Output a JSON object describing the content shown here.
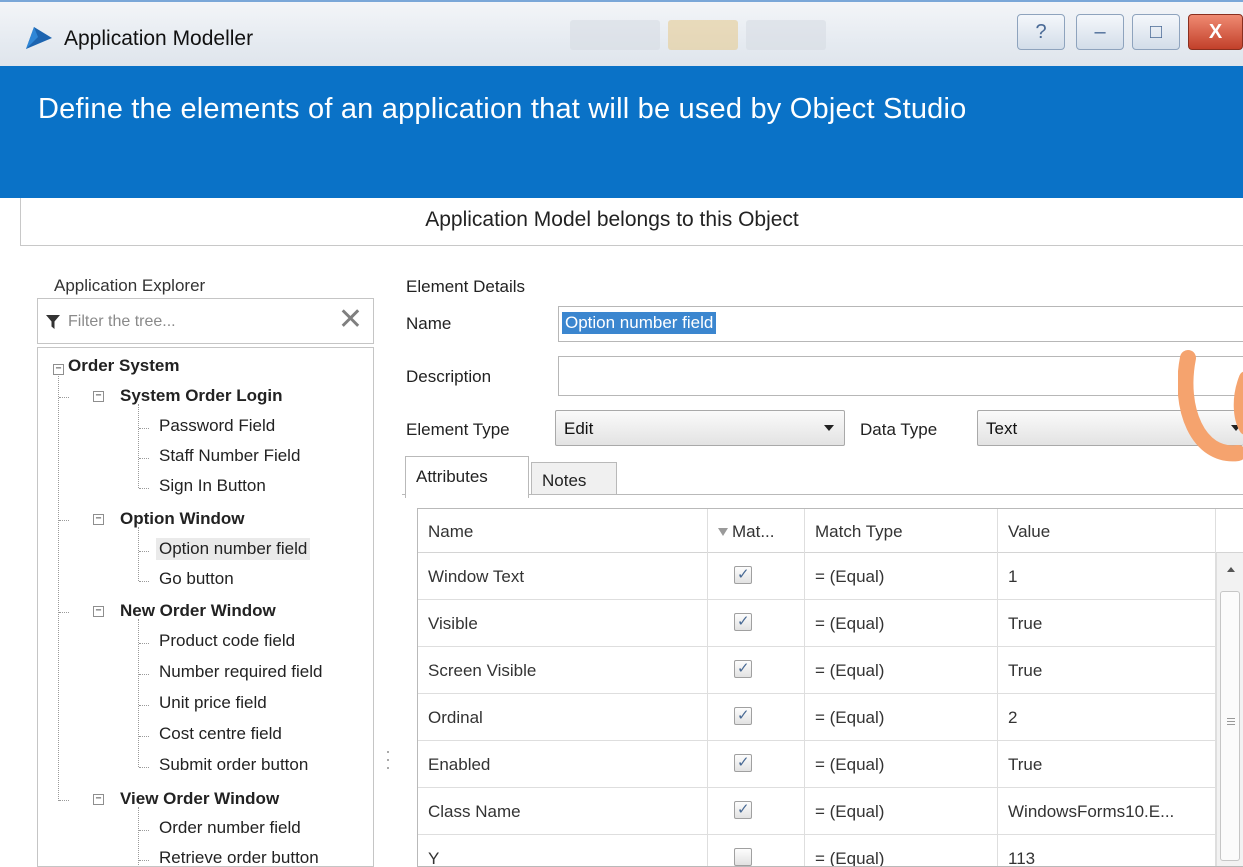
{
  "window": {
    "title": "Application Modeller",
    "controls": {
      "help": "?",
      "minimize": "–",
      "maximize": "□",
      "close": "X"
    },
    "accent_color": "#0a72c7"
  },
  "banner": {
    "text": "Define the elements of an application that will be used by Object Studio"
  },
  "object_bar": {
    "text": "Application Model belongs to this Object"
  },
  "explorer": {
    "label": "Application Explorer",
    "filter_placeholder": "Filter the tree...",
    "root": "Order System",
    "groups": [
      {
        "label": "System Order Login",
        "children": [
          "Password Field",
          "Staff Number Field",
          "Sign In Button"
        ]
      },
      {
        "label": "Option Window",
        "children": [
          "Option number field",
          "Go button"
        ]
      },
      {
        "label": "New Order Window",
        "children": [
          "Product code field",
          "Number required field",
          "Unit price field",
          "Cost centre field",
          "Submit order button"
        ]
      },
      {
        "label": "View Order Window",
        "children": [
          "Order number field",
          "Retrieve order button"
        ]
      }
    ],
    "selected": "Option number field"
  },
  "details": {
    "label": "Element Details",
    "name_label": "Name",
    "name_value": "Option number field",
    "description_label": "Description",
    "element_type_label": "Element Type",
    "element_type_value": "Edit",
    "data_type_label": "Data Type",
    "data_type_value": "Text"
  },
  "tabs": [
    "Attributes",
    "Notes"
  ],
  "grid": {
    "columns": [
      "Name",
      "Mat...",
      "Match Type",
      "Value"
    ],
    "rows": [
      {
        "name": "Window Text",
        "match": true,
        "match_type": "= (Equal)",
        "value": "1"
      },
      {
        "name": "Visible",
        "match": true,
        "match_type": "= (Equal)",
        "value": "True"
      },
      {
        "name": "Screen Visible",
        "match": true,
        "match_type": "= (Equal)",
        "value": "True"
      },
      {
        "name": "Ordinal",
        "match": true,
        "match_type": "= (Equal)",
        "value": "2"
      },
      {
        "name": "Enabled",
        "match": true,
        "match_type": "= (Equal)",
        "value": "True"
      },
      {
        "name": "Class Name",
        "match": true,
        "match_type": "= (Equal)",
        "value": "WindowsForms10.E..."
      },
      {
        "name": "Y",
        "match": false,
        "match_type": "= (Equal)",
        "value": "113"
      }
    ]
  }
}
